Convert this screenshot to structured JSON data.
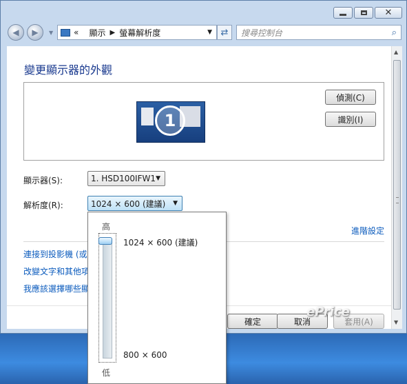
{
  "window": {
    "controls": {
      "minimize": "minimize-icon",
      "maximize": "maximize-icon",
      "close": "close-icon"
    }
  },
  "nav": {
    "address": {
      "prefix": "«",
      "crumbs": [
        "顯示",
        "螢幕解析度"
      ]
    },
    "search_placeholder": "搜尋控制台"
  },
  "page": {
    "title": "變更顯示器的外觀",
    "detect_button": "偵測(C)",
    "identify_button": "識別(I)",
    "monitor_badge": "1",
    "display_label": "顯示器(S):",
    "display_value": "1. HSD100IFW1",
    "resolution_label": "解析度(R):",
    "resolution_value": "1024 × 600 (建議)",
    "advanced_link": "進階設定",
    "links": [
      "連接到投影機 (或",
      "改變文字和其他項",
      "我應該選擇哪些顯"
    ],
    "ok_button": "確定",
    "cancel_button": "取消",
    "apply_button": "套用(A)"
  },
  "resolution_popup": {
    "high_label": "高",
    "low_label": "低",
    "top_option": "1024 × 600 (建議)",
    "bottom_option": "800 × 600",
    "slider_level": 1.0
  },
  "watermark": "ePrice"
}
